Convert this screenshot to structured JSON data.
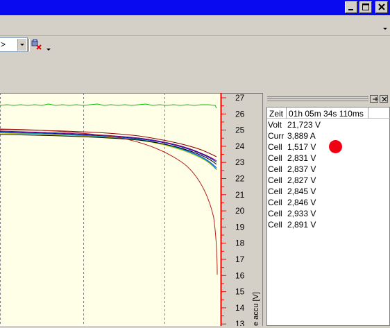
{
  "titlebar": {
    "buttons": [
      "minimize",
      "maximize",
      "close"
    ]
  },
  "toolbar": {
    "combo_value": ">"
  },
  "axis": {
    "right_label": "e accu [V]",
    "ticks": [
      "27",
      "26",
      "25",
      "24",
      "23",
      "22",
      "21",
      "20",
      "19",
      "18",
      "17",
      "16",
      "15",
      "14",
      "13"
    ]
  },
  "panel": {
    "time_label": "Zeit",
    "time_value": "01h 05m 34s 110ms",
    "rows": [
      {
        "label": "Volt",
        "value": "21,723 V"
      },
      {
        "label": "Curr",
        "value": "3,889 A"
      },
      {
        "label": "Cell",
        "value": "1,517 V"
      },
      {
        "label": "Cell",
        "value": "2,831 V"
      },
      {
        "label": "Cell",
        "value": "2,837 V"
      },
      {
        "label": "Cell",
        "value": "2,827 V"
      },
      {
        "label": "Cell",
        "value": "2,845 V"
      },
      {
        "label": "Cell",
        "value": "2,846 V"
      },
      {
        "label": "Cell",
        "value": "2,933 V"
      },
      {
        "label": "Cell",
        "value": "2,891 V"
      }
    ]
  },
  "colors": {
    "titlebar": "#0a0af0",
    "plot_bg": "#ffffe8",
    "axis_red": "#ff0000",
    "alert_dot": "#f00010"
  }
}
